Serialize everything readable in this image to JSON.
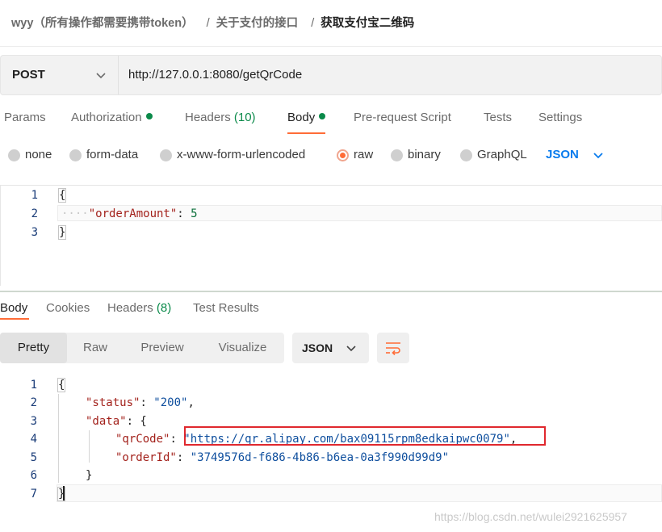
{
  "breadcrumb": {
    "collection": "wyy（所有操作都需要携带token）",
    "separator": "/",
    "folder": "关于支付的接口",
    "request": "获取支付宝二维码"
  },
  "request": {
    "method": "POST",
    "url": "http://127.0.0.1:8080/getQrCode"
  },
  "tabs": [
    {
      "label": "Params"
    },
    {
      "label": "Authorization",
      "dot": true
    },
    {
      "label": "Headers",
      "count": "(10)"
    },
    {
      "label": "Body",
      "dot": true,
      "active": true
    },
    {
      "label": "Pre-request Script"
    },
    {
      "label": "Tests"
    },
    {
      "label": "Settings"
    }
  ],
  "body_modes": {
    "options": [
      "none",
      "form-data",
      "x-www-form-urlencoded",
      "raw",
      "binary",
      "GraphQL"
    ],
    "selected": "raw",
    "language": "JSON"
  },
  "request_body": {
    "line_numbers": [
      "1",
      "2",
      "3"
    ],
    "open_brace": "{",
    "indent_dots": "····",
    "key": "\"orderAmount\"",
    "colon": ":",
    "value": "5",
    "close_brace": "}"
  },
  "response_tabs": [
    {
      "label": "Body",
      "active": true
    },
    {
      "label": "Cookies"
    },
    {
      "label": "Headers",
      "count": "(8)"
    },
    {
      "label": "Test Results"
    }
  ],
  "response_format": {
    "modes": [
      "Pretty",
      "Raw",
      "Preview",
      "Visualize"
    ],
    "selected": "Pretty",
    "language": "JSON"
  },
  "response_body": {
    "line_numbers": [
      "1",
      "2",
      "3",
      "4",
      "5",
      "6",
      "7"
    ],
    "open_brace": "{",
    "status_key": "\"status\"",
    "status_value": "\"200\"",
    "data_key": "\"data\"",
    "qr_key": "\"qrCode\"",
    "qr_value": "\"https://qr.alipay.com/bax09115rpm8edkaipwc0079\"",
    "order_key": "\"orderId\"",
    "order_value": "\"3749576d-f686-4b86-b6ea-0a3f990d99d9\"",
    "inner_close": "}",
    "close_brace": "}"
  },
  "watermark": "https://blog.csdn.net/wulei2921625957",
  "colors": {
    "accent": "#ff6c37",
    "dot_green": "#0b8a4a",
    "link_blue": "#097bed",
    "highlight_red": "#e0282e"
  }
}
